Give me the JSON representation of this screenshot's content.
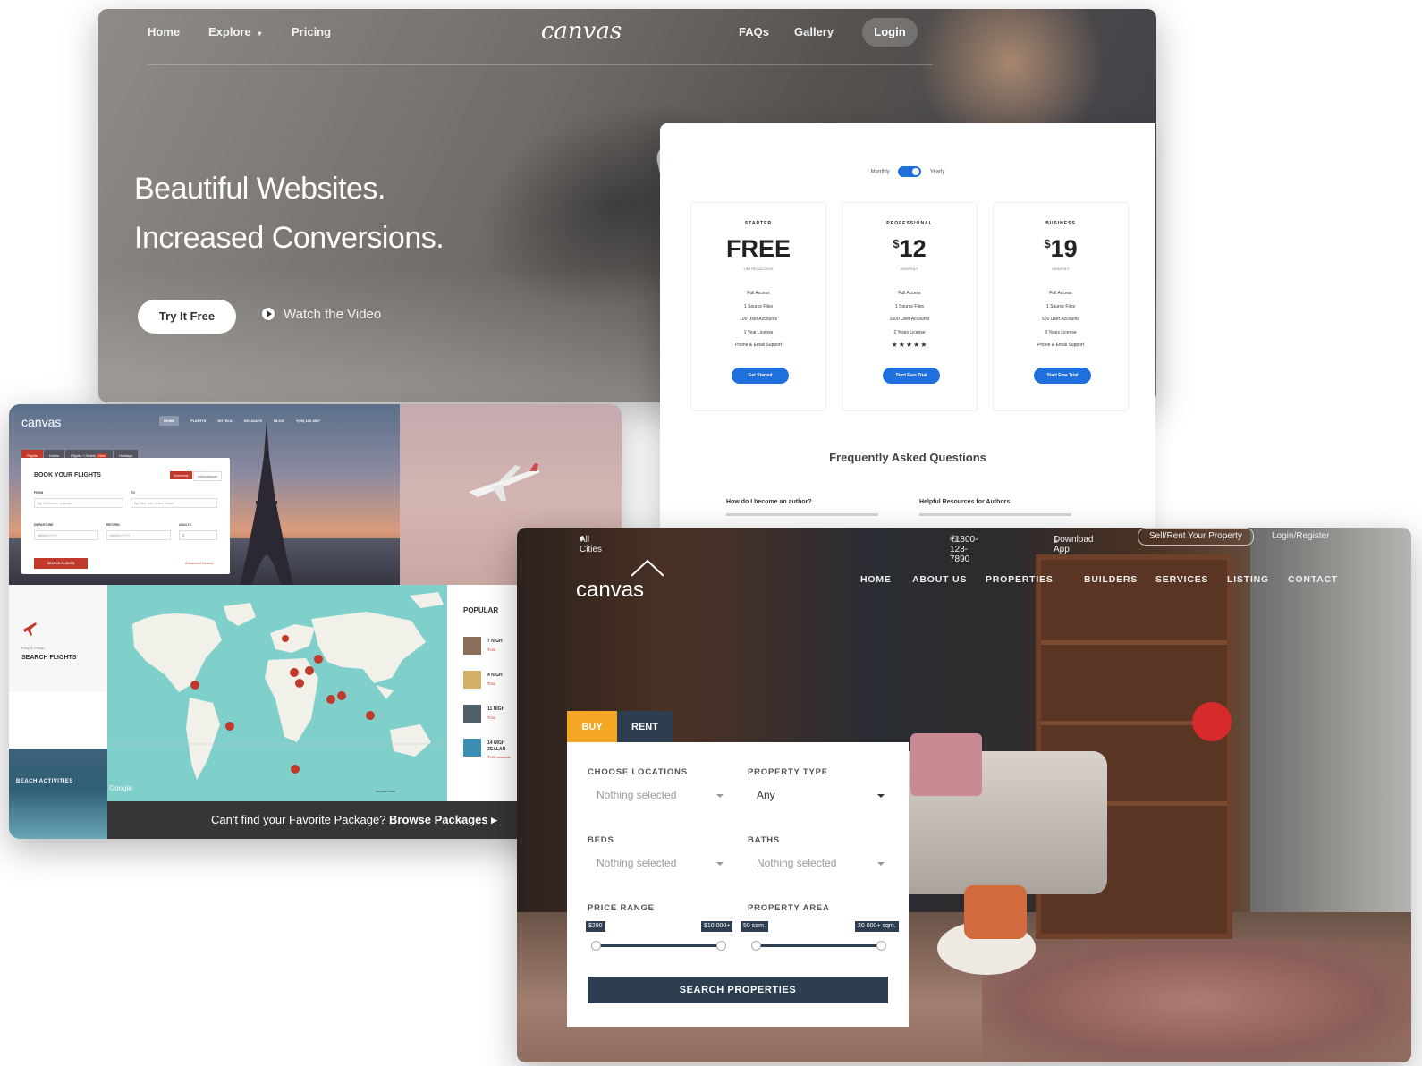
{
  "hero": {
    "nav": {
      "home": "Home",
      "explore": "Explore",
      "pricing": "Pricing",
      "faqs": "FAQs",
      "gallery": "Gallery",
      "login": "Login"
    },
    "logo": "canvas",
    "title_line1": "Beautiful Websites.",
    "title_line2": "Increased Conversions.",
    "cta_primary": "Try It Free",
    "cta_secondary": "Watch the Video"
  },
  "pricing": {
    "toggle_monthly": "Monthly",
    "toggle_yearly": "Yearly",
    "plans": [
      {
        "name": "STARTER",
        "price": "FREE",
        "currency": "",
        "period": "LIMITED ACCESS",
        "features": [
          "Full Access",
          "1 Source Files",
          "100 User Accounts",
          "1 Year License",
          "Phone & Email Support"
        ],
        "button": "Get Started",
        "stars": ""
      },
      {
        "name": "PROFESSIONAL",
        "price": "12",
        "currency": "$",
        "period": "MONTHLY",
        "features": [
          "Full Access",
          "1 Source Files",
          "1000 User Accounts",
          "2 Years License"
        ],
        "button": "Start Free Trial",
        "stars": "★★★★★"
      },
      {
        "name": "BUSINESS",
        "price": "19",
        "currency": "$",
        "period": "MONTHLY",
        "features": [
          "Full Access",
          "1 Source Files",
          "500 User Accounts",
          "3 Years License",
          "Phone & Email Support"
        ],
        "button": "Start Free Trial",
        "stars": ""
      }
    ],
    "faq_title": "Frequently Asked Questions",
    "faq_q1": "How do I become an author?",
    "faq_q2": "Helpful Resources for Authors"
  },
  "travel": {
    "logo": "canvas",
    "nav": [
      "HOME",
      "FLIGHTS",
      "HOTELS",
      "HOLIDAYS",
      "BLOG",
      "+(00) 123 4567"
    ],
    "tabs": [
      "Flights",
      "Hotels",
      "Flights + Hotels",
      "Holidays"
    ],
    "tab_badge": "New",
    "form": {
      "title": "BOOK YOUR FLIGHTS",
      "seg_domestic": "Domestic",
      "seg_international": "International",
      "from_label": "FROM",
      "from_placeholder": "Eg. Melbourne, Australia",
      "to_label": "TO",
      "to_placeholder": "Eg. New York, United States",
      "departure_label": "DEPARTURE",
      "departure_placeholder": "MM/DD/YYYY",
      "return_label": "RETURN",
      "return_placeholder": "MM/DD/YYYY",
      "adults_label": "ADULTS",
      "adults_value": "2",
      "search_button": "SEARCH FLIGHTS",
      "advanced": "Advanced Search"
    },
    "feature_sub": "Easy & Cheap",
    "feature_title": "SEARCH FLIGHTS",
    "map_attrib": "Google",
    "map_data": "Map data ©2016",
    "popular_title": "POPULAR",
    "packages": [
      {
        "title": "7 NIGH",
        "price": "₹200"
      },
      {
        "title": "4 NIGH",
        "price": "₹300"
      },
      {
        "title": "11 NIGH",
        "price": "₹200"
      },
      {
        "title": "14 NIGH",
        "subtitle": "ZEALAN",
        "price": "₹200 onwards"
      }
    ],
    "beach_label": "BEACH ACTIVITIES",
    "bar_text": "Can't find your Favorite Package?",
    "bar_link": "Browse Packages ▸"
  },
  "realestate": {
    "top": {
      "cities": "All Cities",
      "phone": "+1800-123-7890",
      "download": "Download App",
      "sell": "Sell/Rent Your Property",
      "login": "Login/Register"
    },
    "logo": "canvas",
    "nav": [
      "HOME",
      "ABOUT US",
      "PROPERTIES",
      "BUILDERS",
      "SERVICES",
      "LISTING",
      "CONTACT"
    ],
    "tab_buy": "BUY",
    "tab_rent": "RENT",
    "choose_locations_label": "CHOOSE LOCATIONS",
    "choose_locations_value": "Nothing selected",
    "property_type_label": "PROPERTY TYPE",
    "property_type_value": "Any",
    "beds_label": "BEDS",
    "beds_value": "Nothing selected",
    "baths_label": "BATHS",
    "baths_value": "Nothing selected",
    "price_range_label": "PRICE RANGE",
    "price_min": "$200",
    "price_max": "$10 000+",
    "area_label": "PROPERTY AREA",
    "area_min": "50 sqm.",
    "area_max": "20 000+ sqm.",
    "search_button": "SEARCH PROPERTIES"
  },
  "colors": {
    "blue": "#1f6fdc",
    "red": "#c0392b",
    "orange": "#f5a623",
    "navy": "#2c3e50"
  }
}
